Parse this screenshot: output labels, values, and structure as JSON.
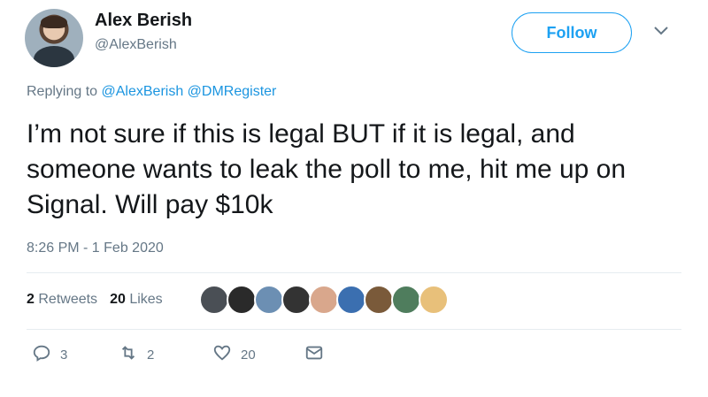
{
  "user": {
    "display_name": "Alex Berish",
    "handle": "@AlexBerish"
  },
  "follow_label": "Follow",
  "replying": {
    "prefix": "Replying to",
    "mentions": [
      "@AlexBerish",
      "@DMRegister"
    ]
  },
  "tweet_text": "I’m not sure if this is legal BUT if it is legal, and someone wants to leak the poll to me, hit me up on Signal. Will pay $10k",
  "timestamp": "8:26 PM - 1 Feb 2020",
  "stats": {
    "retweets_count": "2",
    "retweets_label": "Retweets",
    "likes_count": "20",
    "likes_label": "Likes"
  },
  "liker_avatar_colors": [
    "#4a4f55",
    "#2a2a2a",
    "#6c8fb3",
    "#333333",
    "#d9a78c",
    "#3b6fb0",
    "#7a5a3a",
    "#4f7d5d",
    "#e8c07a"
  ],
  "actions": {
    "reply_count": "3",
    "retweet_count": "2",
    "like_count": "20"
  },
  "colors": {
    "accent": "#1da1f2",
    "secondary_text": "#657786",
    "primary_text": "#14171a"
  },
  "icons": [
    "chevron-down-icon",
    "reply-icon",
    "retweet-icon",
    "heart-icon",
    "message-icon"
  ]
}
